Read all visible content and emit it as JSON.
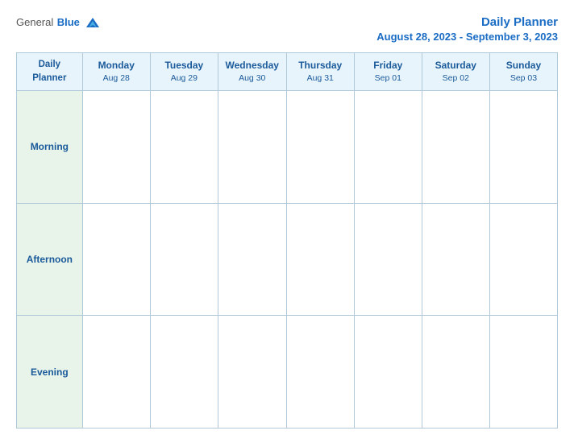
{
  "logo": {
    "general": "General",
    "blue": "Blue"
  },
  "header": {
    "title": "Daily Planner",
    "date_range": "August 28, 2023 - September 3, 2023"
  },
  "table": {
    "planner_label": "Daily\nPlanner",
    "columns": [
      {
        "day": "Monday",
        "date": "Aug 28"
      },
      {
        "day": "Tuesday",
        "date": "Aug 29"
      },
      {
        "day": "Wednesday",
        "date": "Aug 30"
      },
      {
        "day": "Thursday",
        "date": "Aug 31"
      },
      {
        "day": "Friday",
        "date": "Sep 01"
      },
      {
        "day": "Saturday",
        "date": "Sep 02"
      },
      {
        "day": "Sunday",
        "date": "Sep 03"
      }
    ],
    "rows": [
      {
        "label": "Morning"
      },
      {
        "label": "Afternoon"
      },
      {
        "label": "Evening"
      }
    ]
  }
}
